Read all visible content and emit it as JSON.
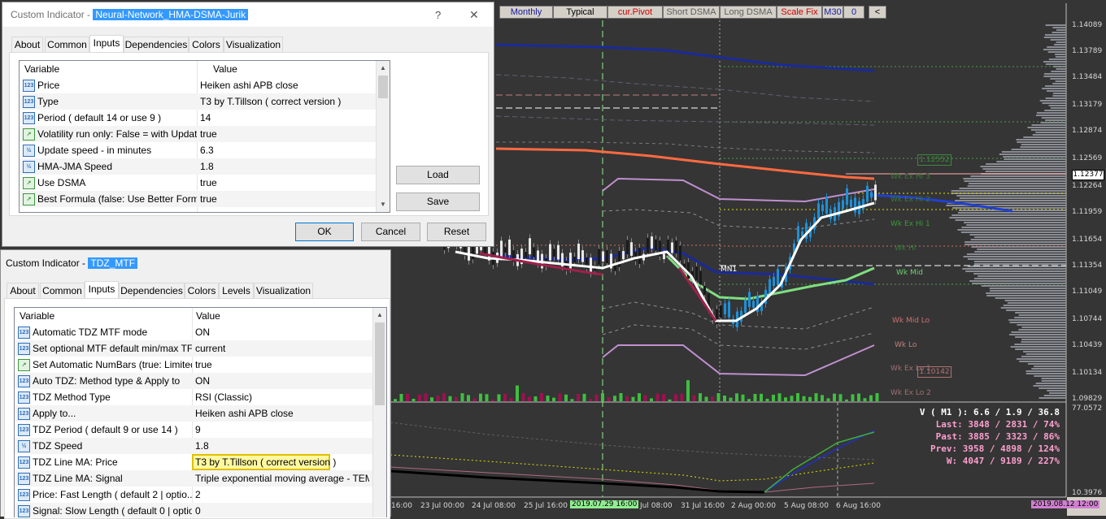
{
  "toolbar": {
    "monthly": "Monthly",
    "typical": "Typical",
    "cur_pivot": "cur.Pivot",
    "short_dsma": "Short DSMA",
    "long_dsma": "Long DSMA",
    "scale_fix": "Scale Fix",
    "m30": "M30",
    "zero": "0",
    "less": "<"
  },
  "price_axis": [
    "1.14089",
    "1.13789",
    "1.13484",
    "1.13179",
    "1.12874",
    "1.12569",
    "1.12264",
    "1.11959",
    "1.11654",
    "1.11354",
    "1.11049",
    "1.10744",
    "1.10439",
    "1.10134",
    "1.09829"
  ],
  "price_boxes": {
    "current": "1.12377",
    "marker_a": "1.12552",
    "marker_b": "1.10142"
  },
  "levels": {
    "wk_ex_hi3": "Wk Ex Hi 3",
    "wk_ex_hi2": "Wk Ex Hi 2",
    "wk_ex_hi1": "Wk Ex Hi 1",
    "wk_hi": "Wk Hi",
    "wk_mid": "Wk Mid",
    "wk_mid_lo": "Wk Mid Lo",
    "wk_lo": "Wk Lo",
    "wk_ex_lo1": "Wk Ex Lo 1",
    "wk_ex_lo2": "Wk Ex Lo 2",
    "mn1": "MN1"
  },
  "sub_axis": {
    "top": "77.0572",
    "bottom": "10.3976"
  },
  "stats": {
    "v": "V ( M1 ): 6.6 / 1.9 / 36.8",
    "last": "Last: 3848 / 2831 / 74%",
    "past": "Past: 3885 / 3323 / 86%",
    "prev": "Prev: 3958 / 4898 / 124%",
    "w": "W: 4047 / 9189 / 227%"
  },
  "time_axis": {
    "t0": "16:00",
    "t1": "23 Jul 00:00",
    "t2": "24 Jul 08:00",
    "t3": "25 Jul 16:00",
    "t4": "2019.07.29 16:00",
    "t5": "Jul 08:00",
    "t6": "31 Jul 16:00",
    "t7": "2 Aug 00:00",
    "t8": "5 Aug 08:00",
    "t9": "6 Aug 16:00",
    "t10": "2019.08.12 12:00"
  },
  "dialog1": {
    "title_prefix": "Custom Indicator - ",
    "title_name": "Neural-Network_HMA-DSMA-Jurik",
    "help": "?",
    "close": "✕",
    "tabs": [
      "About",
      "Common",
      "Inputs",
      "Dependencies",
      "Colors",
      "Visualization"
    ],
    "col_variable": "Variable",
    "col_value": "Value",
    "rows": [
      {
        "name": "Price",
        "value": "Heiken ashi APB close",
        "icon": "123"
      },
      {
        "name": "Type",
        "value": "T3 by T.Tillson ( correct version )",
        "icon": "123"
      },
      {
        "name": "Period ( default 14 or use 9 )",
        "value": "14",
        "icon": "123"
      },
      {
        "name": "Volatility run only: False = with Update ...",
        "value": "true",
        "icon": "bool"
      },
      {
        "name": "Update speed - in minutes",
        "value": "6.3",
        "icon": "1/2"
      },
      {
        "name": "HMA-JMA Speed",
        "value": "1.8",
        "icon": "1/2"
      },
      {
        "name": "Use DSMA",
        "value": "true",
        "icon": "bool"
      },
      {
        "name": "Best Formula (false: Use Better Formul...",
        "value": "true",
        "icon": "bool"
      }
    ],
    "load": "Load",
    "save": "Save",
    "ok": "OK",
    "cancel": "Cancel",
    "reset": "Reset"
  },
  "dialog2": {
    "title_prefix": "Custom Indicator - ",
    "title_name": "TDZ_MTF",
    "tabs": [
      "About",
      "Common",
      "Inputs",
      "Dependencies",
      "Colors",
      "Levels",
      "Visualization"
    ],
    "col_variable": "Variable",
    "col_value": "Value",
    "rows": [
      {
        "name": "Automatic TDZ MTF mode",
        "value": "ON",
        "icon": "123"
      },
      {
        "name": "Set optional MTF default min/max TF",
        "value": "current",
        "icon": "123"
      },
      {
        "name": "Set Automatic NumBars (true: Limited ...",
        "value": "true",
        "icon": "bool"
      },
      {
        "name": "Auto TDZ: Method type & Apply to",
        "value": "ON",
        "icon": "123"
      },
      {
        "name": "TDZ Method Type",
        "value": "RSI (Classic)",
        "icon": "123"
      },
      {
        "name": "Apply to...",
        "value": "Heiken ashi APB close",
        "icon": "123"
      },
      {
        "name": "TDZ Period ( default 9 or use 14 )",
        "value": "9",
        "icon": "123"
      },
      {
        "name": "TDZ Speed",
        "value": "1.8",
        "icon": "1/2"
      },
      {
        "name": "TDZ Line MA: Price",
        "value": "T3 by T.Tillson ( correct version )",
        "icon": "123"
      },
      {
        "name": "TDZ Line MA: Signal",
        "value": "Triple exponential moving average - TEMA",
        "icon": "123"
      },
      {
        "name": "Price:  Fast Length  ( default 2  | optio...",
        "value": "2",
        "icon": "123"
      },
      {
        "name": "Signal: Slow Length  ( default 0  | optio...",
        "value": "0",
        "icon": "123"
      }
    ]
  }
}
